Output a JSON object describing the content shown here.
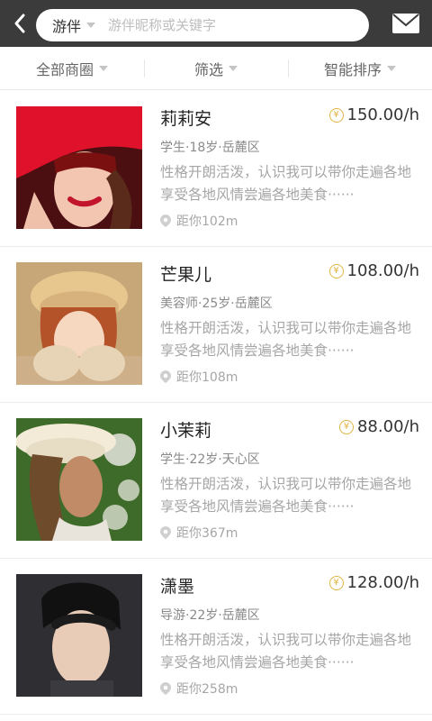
{
  "header": {
    "search_type": "游伴",
    "search_placeholder": "游伴昵称或关键字"
  },
  "filters": [
    {
      "label": "全部商圈"
    },
    {
      "label": "筛选"
    },
    {
      "label": "智能排序"
    }
  ],
  "items": [
    {
      "name": "莉莉安",
      "price": "150.00/h",
      "meta": "学生·18岁·岳麓区",
      "desc": "性格开朗活泼，认识我可以带你走遍各地享受各地风情尝遍各地美食······",
      "dist": "距你102m",
      "avatar_colors": [
        "#e0112a",
        "#7a1010",
        "#f2c6b0"
      ]
    },
    {
      "name": "芒果儿",
      "price": "108.00/h",
      "meta": "美容师·25岁·岳麓区",
      "desc": "性格开朗活泼，认识我可以带你走遍各地享受各地风情尝遍各地美食······",
      "dist": "距你108m",
      "avatar_colors": [
        "#e8c78f",
        "#b4522a",
        "#f6d7c0"
      ]
    },
    {
      "name": "小茉莉",
      "price": "88.00/h",
      "meta": "学生·22岁·天心区",
      "desc": "性格开朗活泼，认识我可以带你走遍各地享受各地风情尝遍各地美食······",
      "dist": "距你367m",
      "avatar_colors": [
        "#3f6b2a",
        "#f1eee8",
        "#c08b66"
      ]
    },
    {
      "name": "潇墨",
      "price": "128.00/h",
      "meta": "导游·22岁·岳麓区",
      "desc": "性格开朗活泼，认识我可以带你走遍各地享受各地风情尝遍各地美食······",
      "dist": "距你258m",
      "avatar_colors": [
        "#2f2f33",
        "#111111",
        "#e9ccb7"
      ]
    }
  ],
  "icons": {
    "back": "back-arrow-icon",
    "dropdown": "chevron-down-icon",
    "mail": "mail-icon",
    "price": "yuan-coin-icon",
    "location": "location-pin-icon"
  },
  "colors": {
    "topbar": "#3b3b3b",
    "coin": "#e1b545",
    "text_dark": "#222222",
    "text_muted": "#a6a6a6"
  }
}
